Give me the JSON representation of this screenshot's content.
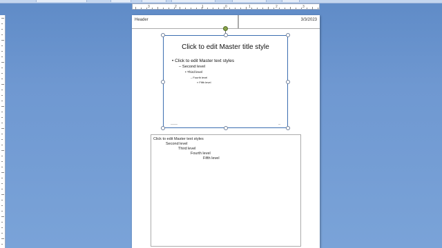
{
  "header": {
    "text": "Header"
  },
  "date": {
    "text": "3/3/2023"
  },
  "slide": {
    "title": "Click to edit Master title style",
    "levels": [
      "Click to edit Master text styles",
      "Second level",
      "Third level",
      "Fourth level",
      "Fifth level"
    ],
    "bullets": [
      "•",
      "–",
      "•",
      "–",
      "»"
    ]
  },
  "notes": {
    "levels": [
      "Click to edit Master text styles",
      "Second level",
      "Third level",
      "Fourth level",
      "Fifth level"
    ]
  },
  "ruler": {
    "numbers": [
      "3",
      "2",
      "1",
      "0",
      "1",
      "2",
      "3"
    ]
  },
  "colors": {
    "background": "#6f98d1",
    "selection": "#3a6db0"
  }
}
